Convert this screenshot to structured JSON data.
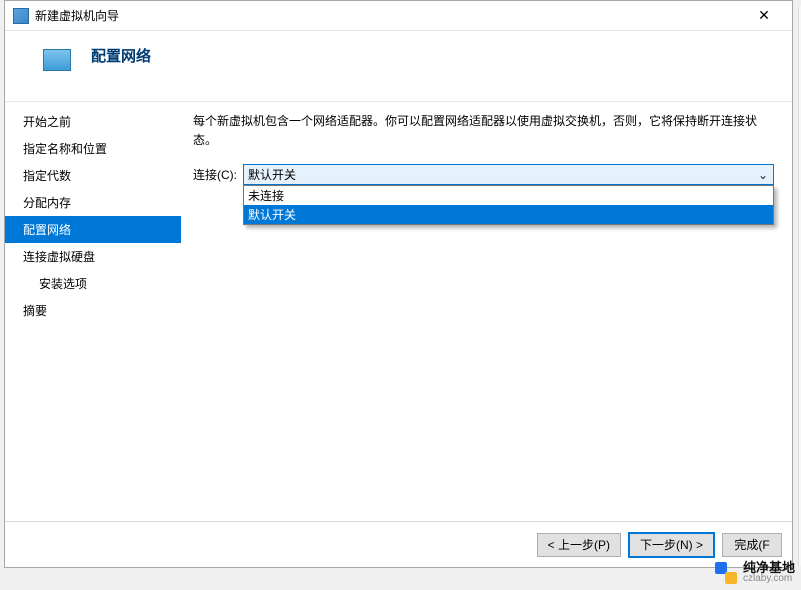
{
  "window": {
    "title": "新建虚拟机向导",
    "close_glyph": "✕"
  },
  "header": {
    "page_title": "配置网络"
  },
  "sidebar": {
    "items": [
      {
        "label": "开始之前",
        "indent": false,
        "active": false
      },
      {
        "label": "指定名称和位置",
        "indent": false,
        "active": false
      },
      {
        "label": "指定代数",
        "indent": false,
        "active": false
      },
      {
        "label": "分配内存",
        "indent": false,
        "active": false
      },
      {
        "label": "配置网络",
        "indent": false,
        "active": true
      },
      {
        "label": "连接虚拟硬盘",
        "indent": false,
        "active": false
      },
      {
        "label": "安装选项",
        "indent": true,
        "active": false
      },
      {
        "label": "摘要",
        "indent": false,
        "active": false
      }
    ]
  },
  "main": {
    "description": "每个新虚拟机包含一个网络适配器。你可以配置网络适配器以使用虚拟交换机，否则，它将保持断开连接状态。",
    "connection_label": "连接(C):",
    "combo": {
      "selected": "默认开关",
      "chevron": "⌄",
      "options": [
        {
          "label": "未连接",
          "selected": false
        },
        {
          "label": "默认开关",
          "selected": true
        }
      ]
    }
  },
  "footer": {
    "prev": "< 上一步(P)",
    "next": "下一步(N) >",
    "finish": "完成(F"
  },
  "watermark": {
    "brand": "纯净基地",
    "url": "czlaby.com"
  }
}
